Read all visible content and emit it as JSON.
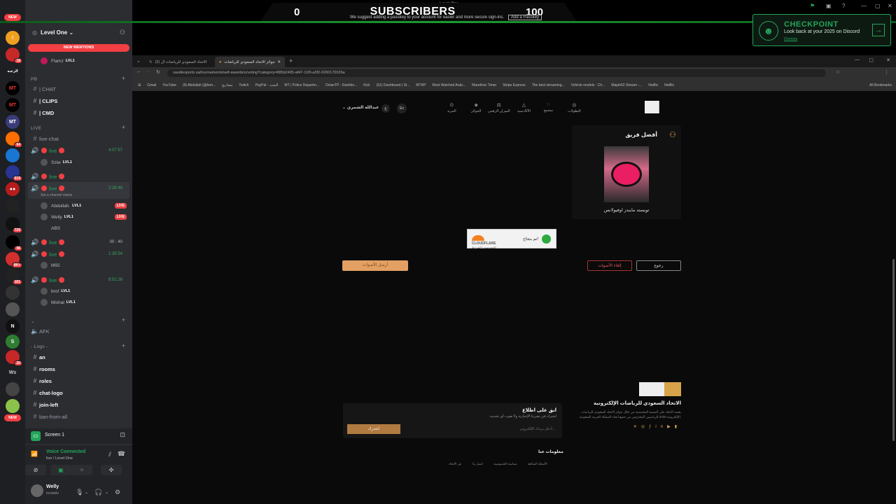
{
  "stream": {
    "subs_left": "0",
    "subs_title": "SUBSCRIBERS",
    "subs_right": "100",
    "window_title": "Level One",
    "notice_text": "We suggest adding a passkey to your account for easier and more secure sign-ins.",
    "notice_button": "Add a Passkey"
  },
  "checkpoint": {
    "title": "CHECKPOINT",
    "subtitle": "Look back at your 2025 on Discord",
    "link": "Dismiss"
  },
  "rail": {
    "new_top": "NEW",
    "new_bottom": "NEW",
    "badges": [
      "11",
      "18",
      "64",
      "619",
      "729",
      "46",
      "8K+",
      "161",
      "20"
    ],
    "text_items": [
      "الرعبة",
      "Ws"
    ]
  },
  "sidebar": {
    "server_name": "Level One",
    "new_mentions": "NEW MENTIONS",
    "top_user": "Flamz",
    "lvl": "LVL1",
    "categories": {
      "pb": "PB",
      "live": "LIVE",
      "logs": "- Logs -"
    },
    "text_channels": [
      "| CHAT",
      "| CLIPS",
      "| CMD"
    ],
    "live_chat": "live-chat",
    "live_label": "live",
    "timers": [
      "4:07:57",
      "2:28:48",
      "00 : 40",
      "1:35:54",
      "8:51:26"
    ],
    "channel_status": "Set a channel status",
    "voice_users": {
      "v1": [
        "Sziw"
      ],
      "v3": [
        "Abdullah.",
        "Welly",
        "ABS"
      ],
      "v5": [
        "M92"
      ],
      "v6": [
        "brof",
        "Mishal"
      ]
    },
    "live_badge": "LIVE",
    "afk": "AFK",
    "log_channels": [
      "an",
      "rooms",
      "roles",
      "chat-logo",
      "join-left",
      "ban-from-all"
    ]
  },
  "screenshare": {
    "label": "Screen 1"
  },
  "voice": {
    "status": "Voice Connected",
    "channel": "live / Level One"
  },
  "user": {
    "name": "Welly",
    "status": "Invisible"
  },
  "browser": {
    "tabs": [
      "(2) الاتحاد السعودي للرياضات ال",
      "جوائز الاتحاد السعودي للرياضات"
    ],
    "url": "saudiesports.sa/tournaments/self-awards/u/voting?category=885b2495-af47-11f0-a3f2-0200170026a",
    "bookmarks": [
      "Gmail",
      "YouTube",
      "(9) Abdullah (@tem...",
      "مشاريع",
      "Twitch",
      "PayPal - البحث",
      "MT | Police Departm...",
      "OvianTP - Dashbo...",
      "Kick",
      "(51) Dashboard | St...",
      "MTRP",
      "Most Watched Arab...",
      "Marathon Timer",
      "Stripe Express",
      "The best streaming...",
      "Vehicle models - Ch...",
      "Majah92 Stream -...",
      "Netflix",
      "Netflix"
    ],
    "all_bookmarks": "All Bookmarks"
  },
  "webpage": {
    "nav": [
      "البطولات",
      "مجتمع",
      "الأكاديمية",
      "الميزان الرقمي",
      "الجوائز",
      "المزيد"
    ],
    "lang": "En",
    "user_name": "عبدالله الشمري",
    "card_title": "أفضل فريق",
    "team_name": "تويستد مايندز اوفيولانس",
    "cloudflare_text": "تم بنجاح!",
    "cloudflare_brand": "CLOUDFLARE",
    "cloudflare_sub": "الخصوصية • الشروط",
    "submit": "أرسل الأصوات",
    "cancel": "إلغاء الأصوات",
    "back": "رجوع",
    "newsletter_title": "ابق على اطلاع",
    "newsletter_desc": "اشترك في نشرتنا الإخبارية ولا تفوت أي تحديث",
    "newsletter_placeholder": "أدخل بريدك الإلكتروني...",
    "newsletter_button": "اشترك",
    "federation_name": "الاتحاد السعودي للرياضات الإلكترونية",
    "federation_desc": "يعتمد الاتحاد على المنصة المخصصة من خلال جوائز الاتحاد السعودي للرياضات الإلكترونية 2025 للرياضيين المحترفين من جميع أنحاء المملكة العربية السعودية.",
    "about": "معلومات عنا",
    "footer_links": [
      "الأسئلة الشائعة",
      "سياسة الخصوصية",
      "اتصل بنا",
      "عن الاتحاد"
    ]
  },
  "colors": {
    "discord_green": "#23a55a",
    "live_red": "#ed4245",
    "accent_gold": "#d8a24a"
  }
}
